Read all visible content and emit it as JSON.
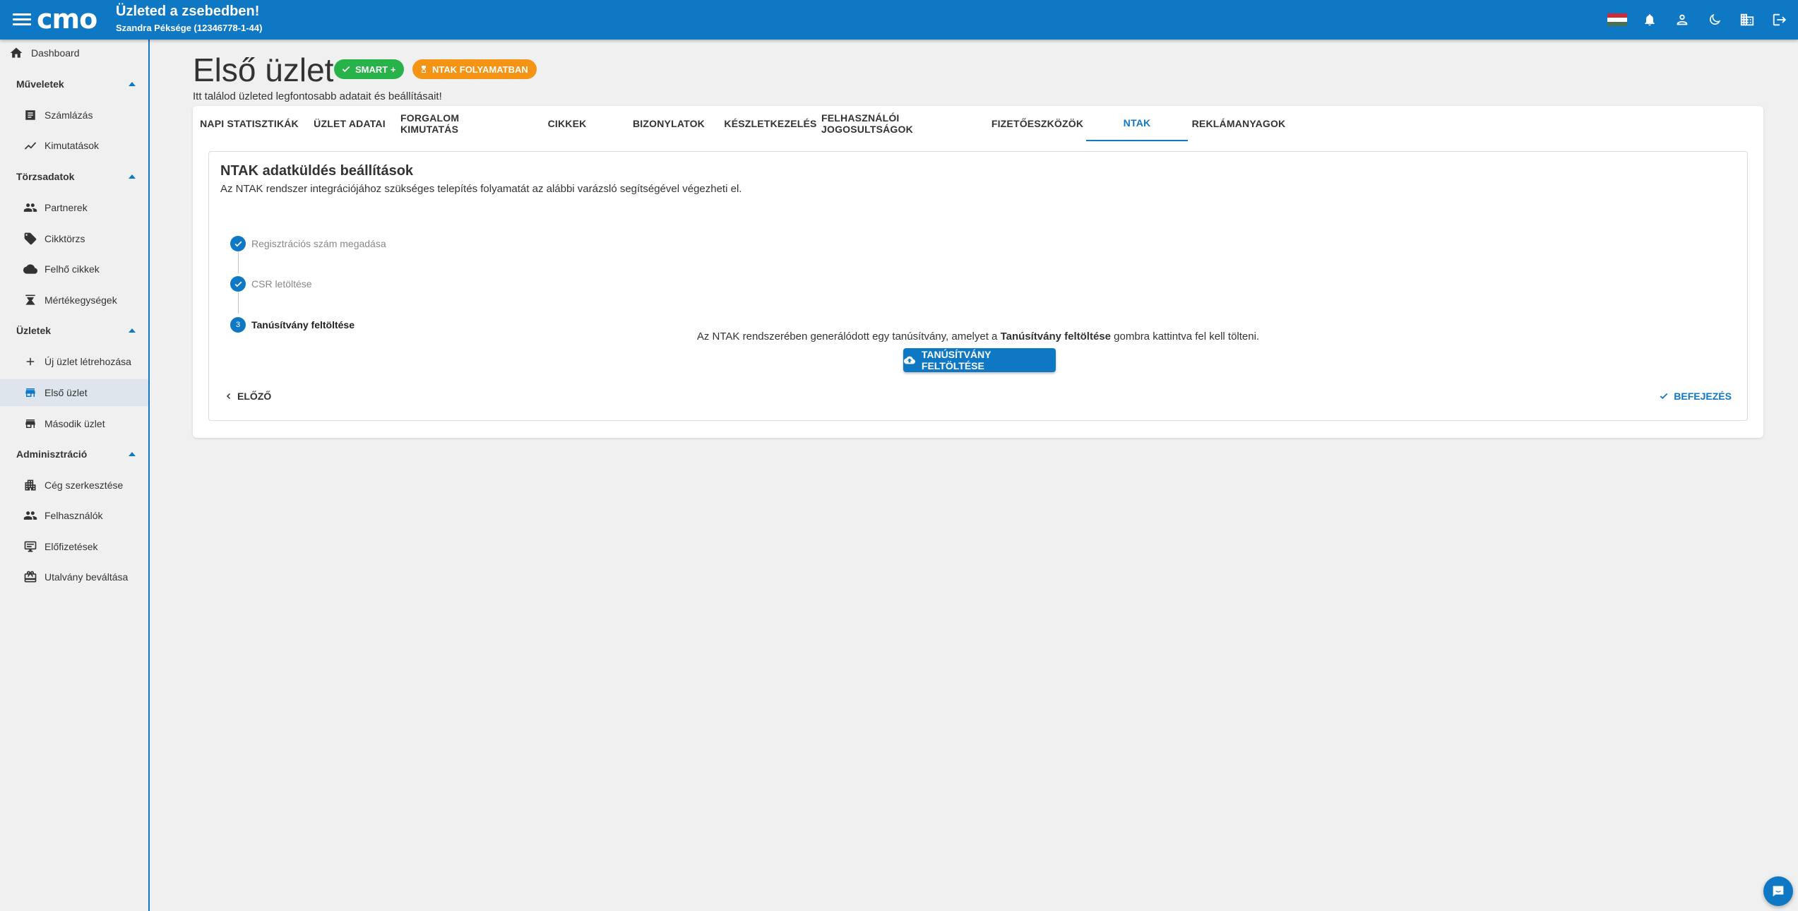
{
  "header": {
    "logo": "cmo",
    "title": "Üzleted a zsebedben!",
    "subtitle": "Szandra Péksége (12346778-1-44)",
    "icons": [
      "hu-flag-icon",
      "bell-icon",
      "user-icon",
      "moon-icon",
      "company-icon",
      "logout-icon"
    ]
  },
  "sidebar": {
    "dashboard": "Dashboard",
    "sections": [
      {
        "label": "Műveletek",
        "items": [
          "Számlázás",
          "Kimutatások"
        ]
      },
      {
        "label": "Törzsadatok",
        "items": [
          "Partnerek",
          "Cikktörzs",
          "Felhő cikkek",
          "Mértékegységek"
        ]
      },
      {
        "label": "Üzletek",
        "items": [
          "Új üzlet létrehozása",
          "Első üzlet",
          "Második üzlet"
        ]
      },
      {
        "label": "Adminisztráció",
        "items": [
          "Cég szerkesztése",
          "Felhasználók",
          "Előfizetések",
          "Utalvány beváltása"
        ]
      }
    ],
    "active_item": "Első üzlet"
  },
  "page": {
    "title": "Első üzlet",
    "badge_smart": "SMART +",
    "badge_ntak": "NTAK FOLYAMATBAN",
    "subtitle": "Itt találod üzleted legfontosabb adatait és beállításait!"
  },
  "tabs": [
    "NAPI STATISZTIKÁK",
    "ÜZLET ADATAI",
    "FORGALOM KIMUTATÁS",
    "CIKKEK",
    "BIZONYLATOK",
    "KÉSZLETKEZELÉS",
    "FELHASZNÁLÓI JOGOSULTSÁGOK",
    "FIZETŐESZKÖZÖK",
    "NTAK",
    "REKLÁMANYAGOK"
  ],
  "active_tab": "NTAK",
  "ntak": {
    "heading": "NTAK adatküldés beállítások",
    "description": "Az NTAK rendszer integrációjához szükséges telepítés folyamatát az alábbi varázsló segítségével végezheti el.",
    "steps": [
      {
        "label": "Regisztrációs szám megadása",
        "status": "done"
      },
      {
        "label": "CSR letöltése",
        "status": "done"
      },
      {
        "label": "Tanúsítvány feltöltése",
        "status": "current",
        "number": "3"
      }
    ],
    "upload_text_before": "Az NTAK rendszerében generálódott egy tanúsítvány, amelyet a ",
    "upload_text_bold": "Tanúsítvány feltöltése",
    "upload_text_after": " gombra kattintva fel kell tölteni.",
    "upload_button": "TANÚSÍTVÁNY FELTÖLTÉSE",
    "prev_button": "ELŐZŐ",
    "finish_button": "BEFEJEZÉS"
  },
  "colors": {
    "primary": "#0f78c4",
    "smart_badge": "#27b24a",
    "ntak_badge": "#f59314"
  }
}
